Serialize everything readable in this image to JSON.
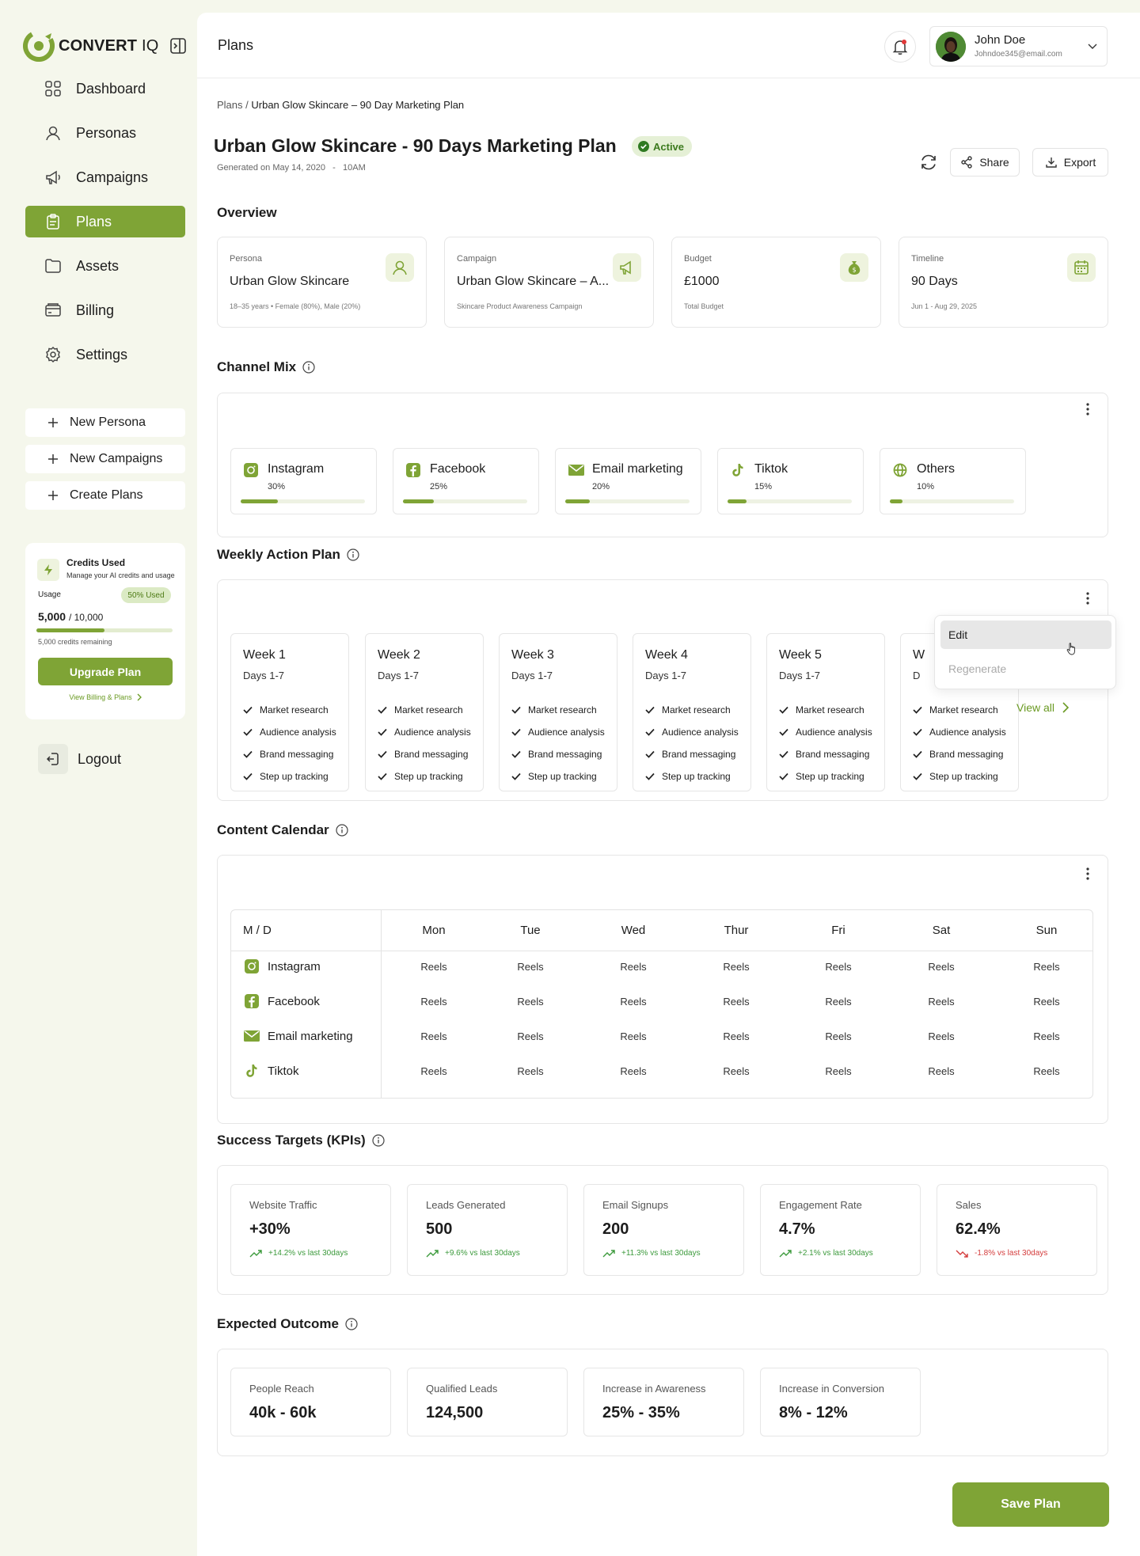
{
  "brand": {
    "name_bold": "CONVERT",
    "name_light": "IQ",
    "accent": "#7fa436"
  },
  "sidebar": {
    "nav": [
      {
        "label": "Dashboard",
        "icon": "grid-icon"
      },
      {
        "label": "Personas",
        "icon": "user-icon"
      },
      {
        "label": "Campaigns",
        "icon": "megaphone-icon"
      },
      {
        "label": "Plans",
        "icon": "clipboard-icon",
        "active": true
      },
      {
        "label": "Assets",
        "icon": "folder-icon"
      },
      {
        "label": "Billing",
        "icon": "card-icon"
      },
      {
        "label": "Settings",
        "icon": "gear-icon"
      }
    ],
    "quick": [
      "New Persona",
      "New Campaigns",
      "Create Plans"
    ],
    "credits": {
      "title": "Credits Used",
      "subtitle": "Manage your AI credits and usage",
      "usage_label": "Usage",
      "badge": "50% Used",
      "used": "5,000",
      "total": "/ 10,000",
      "fraction": 0.5,
      "remaining": "5,000 credits remaining",
      "upgrade": "Upgrade Plan",
      "billing_link": "View Billing & Plans"
    },
    "logout": "Logout"
  },
  "topbar": {
    "title": "Plans",
    "user": {
      "name": "John Doe",
      "email": "Johndoe345@email.com"
    }
  },
  "breadcrumb": {
    "root": "Plans /",
    "current": "Urban Glow Skincare – 90 Day Marketing Plan"
  },
  "page": {
    "title": "Urban Glow Skincare - 90 Days Marketing Plan",
    "status": "Active",
    "generated": "Generated on May 14, 2020",
    "sep": "-",
    "time": "10AM",
    "share": "Share",
    "export": "Export"
  },
  "overview": {
    "title": "Overview",
    "cards": [
      {
        "label": "Persona",
        "value": "Urban Glow Skincare",
        "sub": "18–35 years • Female (80%), Male (20%)",
        "icon": "user-icon"
      },
      {
        "label": "Campaign",
        "value": "Urban Glow Skincare – A...",
        "sub": "Skincare Product Awareness Campaign",
        "icon": "megaphone-icon"
      },
      {
        "label": "Budget",
        "value": "£1000",
        "sub": "Total Budget",
        "icon": "money-bag-icon"
      },
      {
        "label": "Timeline",
        "value": "90 Days",
        "sub": "Jun 1 - Aug 29, 2025",
        "icon": "calendar-icon"
      }
    ]
  },
  "channel_mix": {
    "title": "Channel Mix",
    "channels": [
      {
        "name": "Instagram",
        "pct": "30%",
        "value": 0.3,
        "icon": "instagram-icon"
      },
      {
        "name": "Facebook",
        "pct": "25%",
        "value": 0.25,
        "icon": "facebook-icon"
      },
      {
        "name": "Email marketing",
        "pct": "20%",
        "value": 0.2,
        "icon": "email-icon"
      },
      {
        "name": "Tiktok",
        "pct": "15%",
        "value": 0.15,
        "icon": "tiktok-icon"
      },
      {
        "name": "Others",
        "pct": "10%",
        "value": 0.1,
        "icon": "globe-icon"
      }
    ]
  },
  "weekly": {
    "title": "Weekly Action Plan",
    "weeks": [
      {
        "title": "Week 1",
        "days": "Days 1-7"
      },
      {
        "title": "Week 2",
        "days": "Days 1-7"
      },
      {
        "title": "Week 3",
        "days": "Days 1-7"
      },
      {
        "title": "Week 4",
        "days": "Days 1-7"
      },
      {
        "title": "Week 5",
        "days": "Days 1-7"
      },
      {
        "title": "W",
        "days": "D"
      }
    ],
    "tasks": [
      "Market research",
      "Audience analysis",
      "Brand messaging",
      "Step up tracking"
    ],
    "view_all": "View all",
    "menu": {
      "edit": "Edit",
      "regenerate": "Regenerate"
    }
  },
  "calendar": {
    "title": "Content Calendar",
    "corner": "M / D",
    "days": [
      "Mon",
      "Tue",
      "Wed",
      "Thur",
      "Fri",
      "Sat",
      "Sun"
    ],
    "rows": [
      {
        "channel": "Instagram",
        "icon": "instagram-icon",
        "cells": [
          "Reels",
          "Reels",
          "Reels",
          "Reels",
          "Reels",
          "Reels",
          "Reels"
        ]
      },
      {
        "channel": "Facebook",
        "icon": "facebook-icon",
        "cells": [
          "Reels",
          "Reels",
          "Reels",
          "Reels",
          "Reels",
          "Reels",
          "Reels"
        ]
      },
      {
        "channel": "Email marketing",
        "icon": "email-icon",
        "cells": [
          "Reels",
          "Reels",
          "Reels",
          "Reels",
          "Reels",
          "Reels",
          "Reels"
        ]
      },
      {
        "channel": "Tiktok",
        "icon": "tiktok-icon",
        "cells": [
          "Reels",
          "Reels",
          "Reels",
          "Reels",
          "Reels",
          "Reels",
          "Reels"
        ]
      }
    ]
  },
  "kpis": {
    "title": "Success Targets (KPIs)",
    "items": [
      {
        "label": "Website Traffic",
        "value": "+30%",
        "delta": "+14.2% vs last 30days",
        "trend": "up"
      },
      {
        "label": "Leads Generated",
        "value": "500",
        "delta": "+9.6% vs last 30days",
        "trend": "up"
      },
      {
        "label": "Email Signups",
        "value": "200",
        "delta": "+11.3% vs last 30days",
        "trend": "up"
      },
      {
        "label": "Engagement Rate",
        "value": "4.7%",
        "delta": "+2.1% vs last 30days",
        "trend": "up"
      },
      {
        "label": "Sales",
        "value": "62.4%",
        "delta": "-1.8% vs last 30days",
        "trend": "down"
      }
    ],
    "up_color": "#3c9a3c",
    "down_color": "#d43c3c"
  },
  "outcome": {
    "title": "Expected Outcome",
    "items": [
      {
        "label": "People Reach",
        "value": "40k - 60k"
      },
      {
        "label": "Qualified Leads",
        "value": "124,500"
      },
      {
        "label": "Increase in Awareness",
        "value": "25% - 35%"
      },
      {
        "label": "Increase in Conversion",
        "value": "8% - 12%"
      }
    ]
  },
  "save": "Save Plan"
}
